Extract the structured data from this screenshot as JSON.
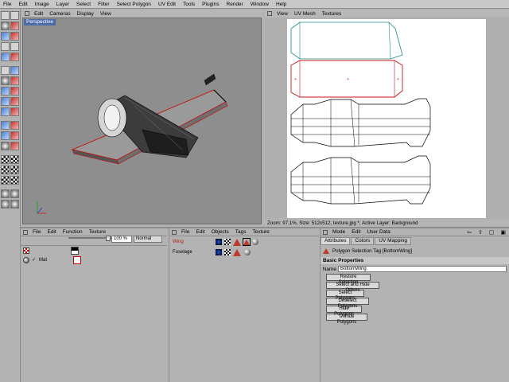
{
  "menubar": {
    "items": [
      "File",
      "Edit",
      "Image",
      "Layer",
      "Select",
      "Filter",
      "Select Polygon",
      "UV Edit",
      "Tools",
      "Plugins",
      "Render",
      "Window",
      "Help"
    ]
  },
  "viewport": {
    "menu": [
      "Edit",
      "Cameras",
      "Display",
      "View"
    ],
    "label": "Perspective"
  },
  "uvpanel": {
    "menu": [
      "View",
      "UV Mesh",
      "Textures"
    ],
    "status": "Zoom: 97.1%, Size: 512x512, texture.jpg *, Active Layer: Background"
  },
  "materials": {
    "menu": [
      "File",
      "Edit",
      "Function",
      "Texture"
    ],
    "zoom": "100 %",
    "mode": "Normal",
    "mat_name": "Mat"
  },
  "objects": {
    "menu": [
      "File",
      "Edit",
      "Objects",
      "Tags",
      "Texture"
    ],
    "items": [
      {
        "name": "Wing",
        "color": "#b02020"
      },
      {
        "name": "Fuselage",
        "color": "#000000"
      }
    ]
  },
  "attributes": {
    "menu": [
      "Mode",
      "Edit",
      "User Data"
    ],
    "tabs": [
      "Attributes",
      "Colors",
      "UV Mapping"
    ],
    "tag_title": "Polygon Selection Tag [BottomWing]",
    "section": "Basic Properties",
    "name_label": "Name",
    "name_value": "BottomWing",
    "buttons": [
      "Restore Selection",
      "Select and Hide Others",
      "Select Polygons",
      "Deselect Polygons",
      "Hide Polygons",
      "Unhide Polygons"
    ]
  }
}
